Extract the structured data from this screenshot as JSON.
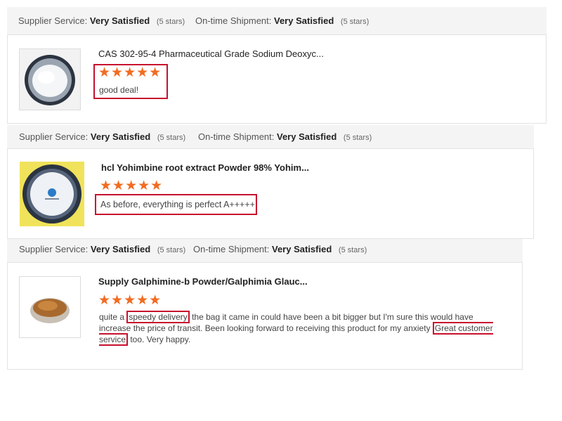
{
  "reviews": [
    {
      "supplier_label": "Supplier Service:",
      "supplier_value": "Very Satisfied",
      "supplier_stars": "(5 stars)",
      "shipment_label": "On-time Shipment:",
      "shipment_value": "Very Satisfied",
      "shipment_stars": "(5 stars)",
      "product_title": "CAS 302-95-4 Pharmaceutical Grade Sodium Deoxyc...",
      "stars": "★★★★★",
      "rating": 5,
      "comment": "good deal!"
    },
    {
      "supplier_label": "Supplier Service:",
      "supplier_value": "Very Satisfied",
      "supplier_stars": "(5 stars)",
      "shipment_label": "On-time Shipment:",
      "shipment_value": "Very Satisfied",
      "shipment_stars": "(5 stars)",
      "product_title": "hcl Yohimbine root extract Powder 98% Yohim...",
      "stars": "★★★★★",
      "rating": 5,
      "comment": "As before, everything is perfect A+++++"
    },
    {
      "supplier_label": "Supplier Service:",
      "supplier_value": "Very Satisfied",
      "supplier_stars": "(5 stars)",
      "shipment_label": "On-time Shipment:",
      "shipment_value": "Very Satisfied",
      "shipment_stars": "(5 stars)",
      "product_title": "Supply Galphimine-b Powder/Galphimia Glauc...",
      "stars": "★★★★★",
      "rating": 5,
      "comment_part1": "quite a ",
      "comment_hl1": "speedy delivery",
      "comment_part2": " the bag it came in could have been a bit bigger but I'm sure this would have increase the price of transit. Been looking forward to receiving this product for my anxiety ",
      "comment_hl2": "Great customer service",
      "comment_part3": " too. Very happy."
    }
  ],
  "colors": {
    "star": "#f26b21",
    "highlight_border": "#c8102e"
  }
}
